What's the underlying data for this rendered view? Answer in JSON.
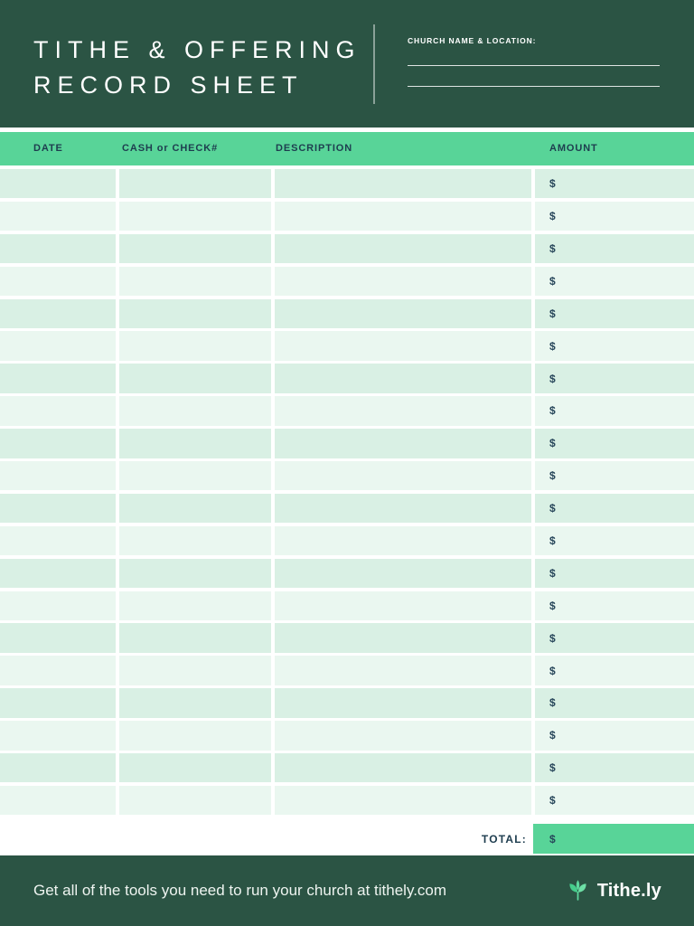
{
  "header": {
    "title_line1": "TITHE & OFFERING",
    "title_line2": "RECORD SHEET",
    "church_field_label": "CHURCH NAME & LOCATION:",
    "church_field_blank_lines": 2
  },
  "table": {
    "columns": [
      {
        "key": "date",
        "label": "DATE"
      },
      {
        "key": "cash_or_check",
        "label": "CASH or CHECK#"
      },
      {
        "key": "description",
        "label": "DESCRIPTION"
      },
      {
        "key": "amount",
        "label": "AMOUNT"
      }
    ],
    "row_count": 20,
    "cells_blank": true,
    "currency_symbol": "$"
  },
  "total_row": {
    "label": "TOTAL:",
    "currency_symbol": "$",
    "value": ""
  },
  "footer": {
    "tagline": "Get all of the tools you need to run your church at tithely.com",
    "brand_name": "Tithe.ly",
    "brand_icon": "sprout-leaf-icon"
  },
  "colors": {
    "dark_green": "#2b5444",
    "accent_green": "#58d498",
    "row_stripe_dark": "#d9f0e4",
    "row_stripe_light": "#eaf7f0",
    "ink": "#1e3d4f",
    "white": "#ffffff"
  }
}
